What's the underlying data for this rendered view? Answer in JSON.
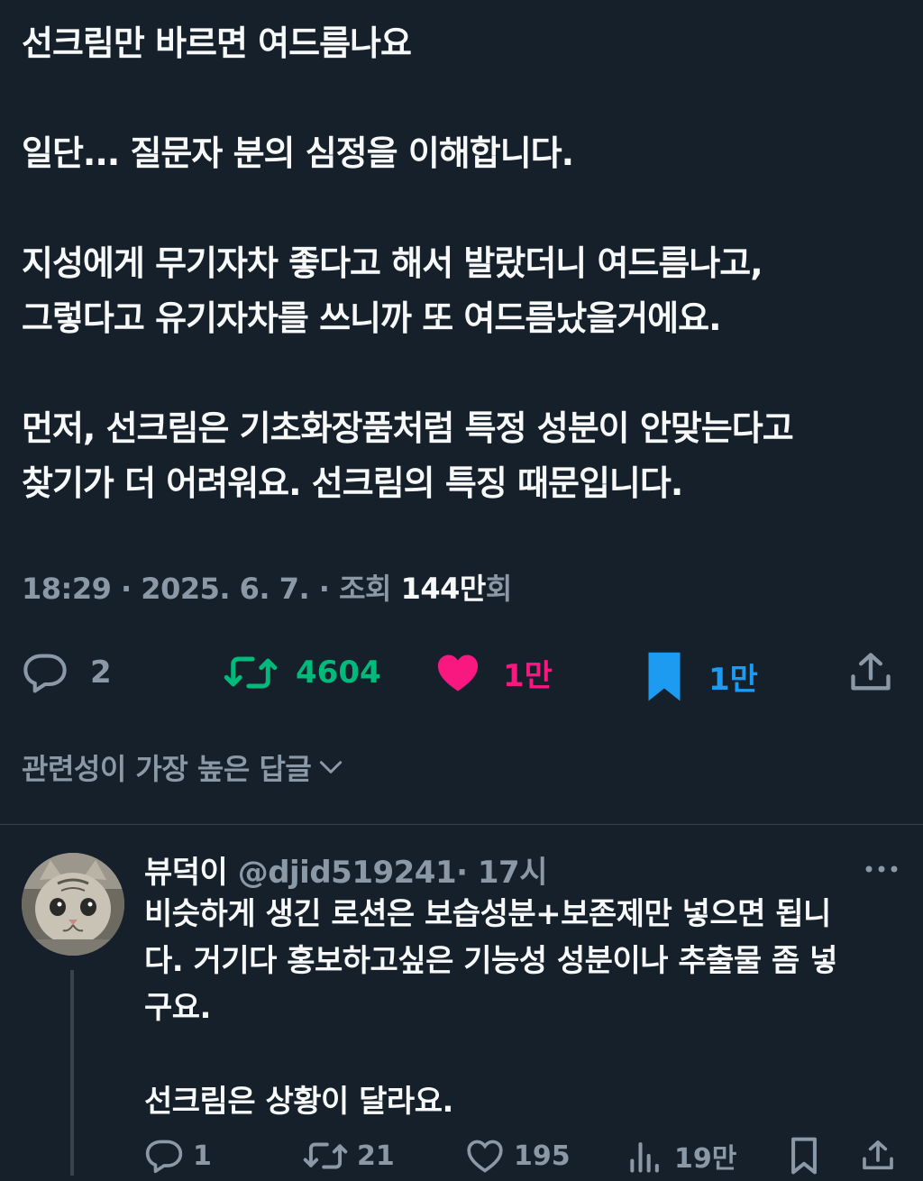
{
  "post": {
    "paragraphs": [
      [
        "선크림만 바르면 여드름나요"
      ],
      [
        "일단... 질문자 분의 심정을 이해합니다."
      ],
      [
        "지성에게 무기자차 좋다고 해서 발랐더니 여드름나고,",
        "그렇다고 유기자차를 쓰니까 또 여드름났을거에요."
      ],
      [
        "먼저, 선크림은 기초화장품처럼 특정 성분이 안맞는다고",
        "찾기가 더 어려워요. 선크림의 특징 때문입니다."
      ]
    ],
    "meta": {
      "time_date": "18:29 · 2025. 6. 7. · 조회 ",
      "views_number": "144만",
      "views_suffix": "회"
    },
    "actions": {
      "reply_count": "2",
      "retweet_count": "4604",
      "like_count": "1만",
      "bookmark_count": "1만"
    },
    "colors": {
      "retweet": "#00ba7c",
      "like": "#f91880",
      "bookmark": "#1d9bf0",
      "muted": "#8b98a5"
    }
  },
  "sort_label": "관련성이 가장 높은 답글",
  "reply": {
    "display_name": "뷰덕이",
    "handle": "@djid519241",
    "time": "· 17시",
    "lines": [
      "비슷하게 생긴 로션은 보습성분+보존제만 넣으면 됩니",
      "다. 거기다 홍보하고싶은 기능성 성분이나 추출물 좀 넣",
      "구요."
    ],
    "lines2": [
      "선크림은 상황이 달라요."
    ],
    "actions": {
      "reply_count": "1",
      "retweet_count": "21",
      "like_count": "195",
      "views_count": "19만"
    }
  }
}
